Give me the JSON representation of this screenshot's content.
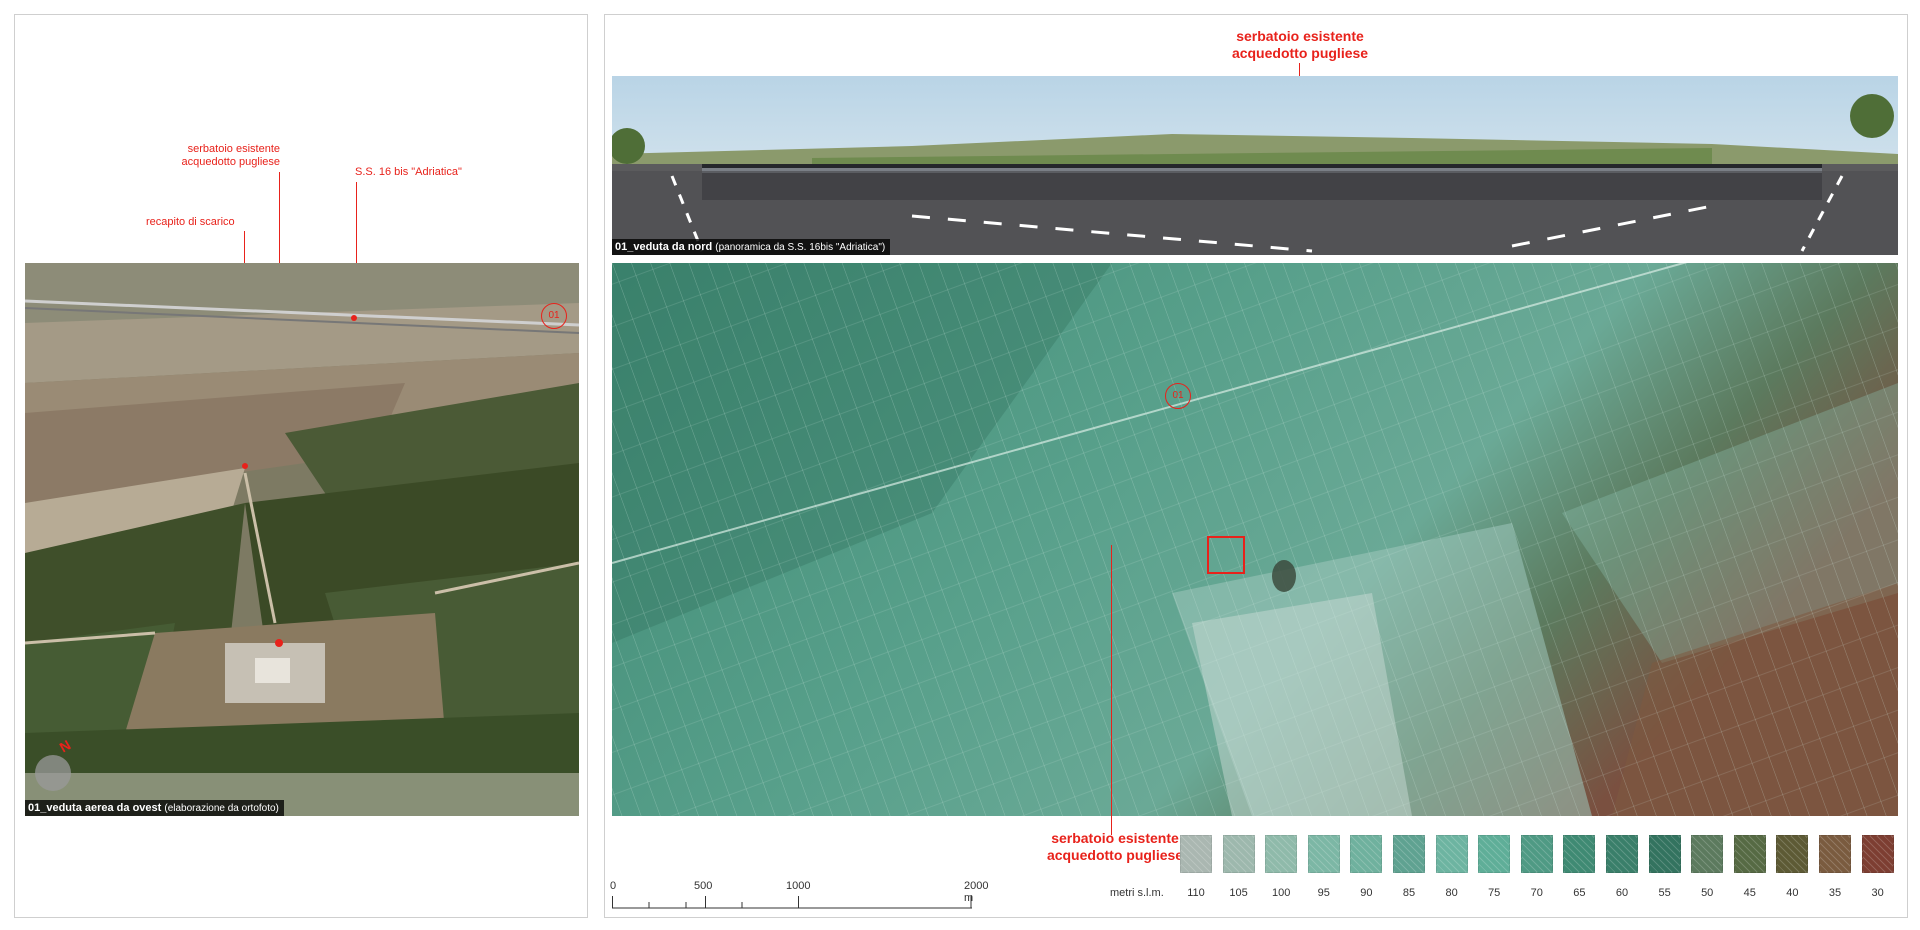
{
  "left": {
    "annotations": {
      "reservoir_line1": "serbatoio esistente",
      "reservoir_line2": "acquedotto pugliese",
      "road": "S.S. 16 bis \"Adriatica\"",
      "discharge": "recapito di scarico"
    },
    "marker": "01",
    "north_label": "N",
    "caption_title": "01_veduta aerea da ovest",
    "caption_sub": "(elaborazione da ortofoto)"
  },
  "right": {
    "top_annotation_line1": "serbatoio esistente",
    "top_annotation_line2": "acquedotto pugliese",
    "pano_caption_title": "01_veduta da nord",
    "pano_caption_sub": "(panoramica da S.S. 16bis \"Adriatica\")",
    "map_marker": "01",
    "bottom_annotation_line1": "serbatoio esistente",
    "bottom_annotation_line2": "acquedotto pugliese",
    "scale": {
      "ticks": [
        "0",
        "500",
        "1000",
        "2000 m"
      ]
    },
    "legend": {
      "title": "metri s.l.m.",
      "items": [
        {
          "label": "110",
          "color": "#aab7b1"
        },
        {
          "label": "105",
          "color": "#9db8ad"
        },
        {
          "label": "100",
          "color": "#8fbaaa"
        },
        {
          "label": "95",
          "color": "#7cb7a5"
        },
        {
          "label": "90",
          "color": "#6fb19e"
        },
        {
          "label": "85",
          "color": "#5fa291"
        },
        {
          "label": "80",
          "color": "#6db4a1"
        },
        {
          "label": "75",
          "color": "#5fae98"
        },
        {
          "label": "70",
          "color": "#4f9a84"
        },
        {
          "label": "65",
          "color": "#3f8a73"
        },
        {
          "label": "60",
          "color": "#3a7f6a"
        },
        {
          "label": "55",
          "color": "#33735f"
        },
        {
          "label": "50",
          "color": "#5c7a5e"
        },
        {
          "label": "45",
          "color": "#566a44"
        },
        {
          "label": "40",
          "color": "#5d5a35"
        },
        {
          "label": "35",
          "color": "#7a5b3f"
        },
        {
          "label": "30",
          "color": "#7d3e32"
        }
      ]
    }
  },
  "colors": {
    "accent_red": "#e8221b"
  }
}
